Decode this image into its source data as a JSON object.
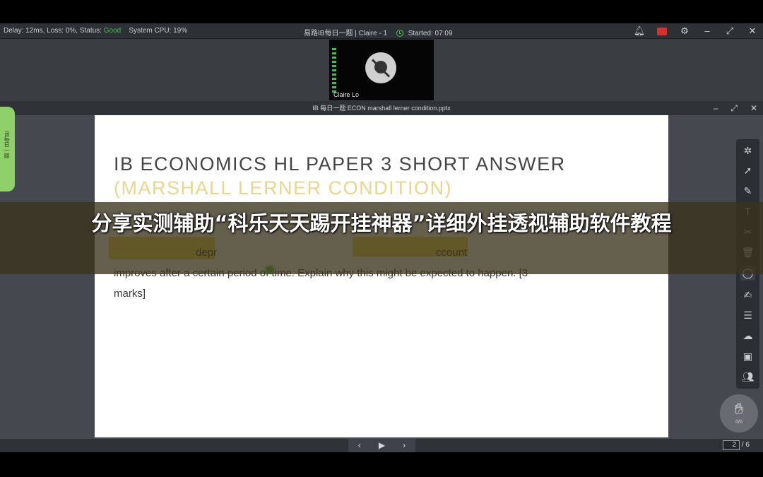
{
  "topbar": {
    "status_prefix": "Delay: 12ms, Loss: 0%, Status: ",
    "status_good": "Good",
    "system_cpu": "System CPU: 19%",
    "room_title": "易路IB每日一题 | Claire - 1",
    "started": "Started: 07:09"
  },
  "video": {
    "participant_name": "Claire Lo",
    "camera_icon": "camera-off-icon"
  },
  "document": {
    "filename": "IB 每日一题 ECON marshall lerner condition.pptx"
  },
  "side_tab": {
    "label": "IB每日一题"
  },
  "slide": {
    "title_line1": "IB ECONOMICS HL PAPER 3 SHORT ANSWER",
    "title_line2": "(MARSHALL LERNER CONDITION)",
    "body_line1_a": "depr",
    "body_line1_b": "ccount",
    "body_line2": "improves after a certain period of time. Explain why this might be expected to happen. [3",
    "body_line3": "marks]"
  },
  "tools": [
    {
      "name": "laser-pointer-icon"
    },
    {
      "name": "select-move-icon"
    },
    {
      "name": "pen-icon"
    },
    {
      "name": "text-icon"
    },
    {
      "name": "scissors-icon"
    },
    {
      "name": "delete-icon"
    },
    {
      "name": "shape-icon"
    },
    {
      "name": "formula-icon"
    },
    {
      "name": "comment-icon"
    },
    {
      "name": "cloud-icon"
    },
    {
      "name": "toolbox-icon"
    },
    {
      "name": "users-icon"
    }
  ],
  "hand_raise": {
    "count": "0/0"
  },
  "pager": {
    "current": "2",
    "total": "/ 6"
  },
  "banner": {
    "text": "分享实测辅助“科乐天天踢开挂神器”详细外挂透视辅助软件教程"
  },
  "colors": {
    "status_good": "#3fbf56",
    "title_accent": "#e9d68c",
    "highlight": "#f2df4e",
    "side_tab": "#8fd06a"
  }
}
